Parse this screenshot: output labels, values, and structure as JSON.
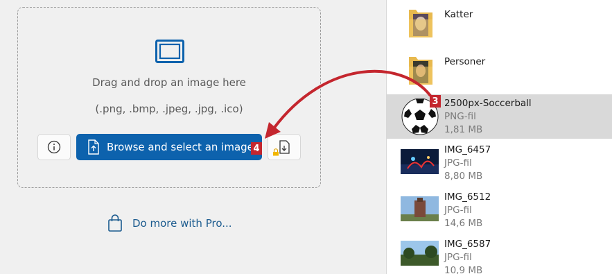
{
  "left": {
    "drop_text": "Drag and drop an image here",
    "formats_text": "(.png, .bmp, .jpeg, .jpg, .ico)",
    "browse_label": "Browse and select an image",
    "browse_badge": "4",
    "pro_link": "Do more with Pro..."
  },
  "right": {
    "folders": [
      {
        "name": "Katter"
      },
      {
        "name": "Personer"
      }
    ],
    "files": [
      {
        "name": "2500px-Soccerball",
        "type": "PNG-fil",
        "size": "1,81 MB",
        "badge": "3",
        "selected": true
      },
      {
        "name": "IMG_6457",
        "type": "JPG-fil",
        "size": "8,80 MB"
      },
      {
        "name": "IMG_6512",
        "type": "JPG-fil",
        "size": "14,6 MB"
      },
      {
        "name": "IMG_6587",
        "type": "JPG-fil",
        "size": "10,9 MB"
      }
    ]
  },
  "colors": {
    "accent": "#0d62ad",
    "badge": "#c4262e",
    "arrow": "#c4262e",
    "selected_row": "#d9d9d9"
  },
  "icons": [
    "image-placeholder-icon",
    "info-icon",
    "file-upload-icon",
    "paste-icon",
    "lock-icon",
    "shopping-bag-icon",
    "folder-icon"
  ]
}
